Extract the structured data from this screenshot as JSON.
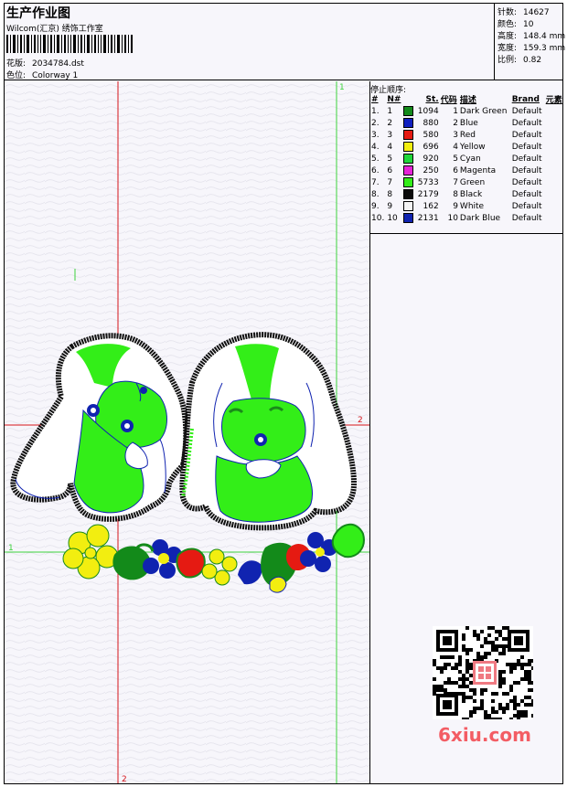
{
  "header": {
    "title": "生产作业图",
    "company": "Wilcom(汇京) 绣饰工作室",
    "design_label": "花版:",
    "design_value": "2034784.dst",
    "colorway_label": "色位:",
    "colorway_value": "Colorway 1"
  },
  "stats": [
    {
      "label": "针数:",
      "value": "14627"
    },
    {
      "label": "颜色:",
      "value": "10"
    },
    {
      "label": "高度:",
      "value": "148.4 mm"
    },
    {
      "label": "宽度:",
      "value": "159.3 mm"
    },
    {
      "label": "比例:",
      "value": "0.82"
    }
  ],
  "stop_sequence": {
    "heading": "停止顺序:",
    "columns": [
      "#",
      "N#",
      "St.",
      "代码",
      "描述",
      "Brand",
      "元素"
    ],
    "rows": [
      {
        "idx": "1.",
        "n": "1",
        "color": "#138a1a",
        "st": "1094",
        "code": "1",
        "desc": "Dark Green",
        "brand": "Default"
      },
      {
        "idx": "2.",
        "n": "2",
        "color": "#0f1fbf",
        "st": "880",
        "code": "2",
        "desc": "Blue",
        "brand": "Default"
      },
      {
        "idx": "3.",
        "n": "3",
        "color": "#e51a12",
        "st": "580",
        "code": "3",
        "desc": "Red",
        "brand": "Default"
      },
      {
        "idx": "4.",
        "n": "4",
        "color": "#f2ee10",
        "st": "696",
        "code": "4",
        "desc": "Yellow",
        "brand": "Default"
      },
      {
        "idx": "5.",
        "n": "5",
        "color": "#1fd63a",
        "st": "920",
        "code": "5",
        "desc": "Cyan",
        "brand": "Default"
      },
      {
        "idx": "6.",
        "n": "6",
        "color": "#e622d8",
        "st": "250",
        "code": "6",
        "desc": "Magenta",
        "brand": "Default"
      },
      {
        "idx": "7.",
        "n": "7",
        "color": "#33ee18",
        "st": "5733",
        "code": "7",
        "desc": "Green",
        "brand": "Default"
      },
      {
        "idx": "8.",
        "n": "8",
        "color": "#0a0a0a",
        "st": "2179",
        "code": "8",
        "desc": "Black",
        "brand": "Default"
      },
      {
        "idx": "9.",
        "n": "9",
        "color": "#f4f4f4",
        "st": "162",
        "code": "9",
        "desc": "White",
        "brand": "Default"
      },
      {
        "idx": "10.",
        "n": "10",
        "color": "#1023b0",
        "st": "2131",
        "code": "10",
        "desc": "Dark Blue",
        "brand": "Default"
      }
    ]
  },
  "canvas": {
    "guide_labels": {
      "top": "1",
      "right": "2",
      "left": "1",
      "bottom": "2"
    },
    "line_colors": {
      "red": "#d4141a",
      "green": "#3cd23c"
    }
  },
  "watermark": "6xiu.com"
}
